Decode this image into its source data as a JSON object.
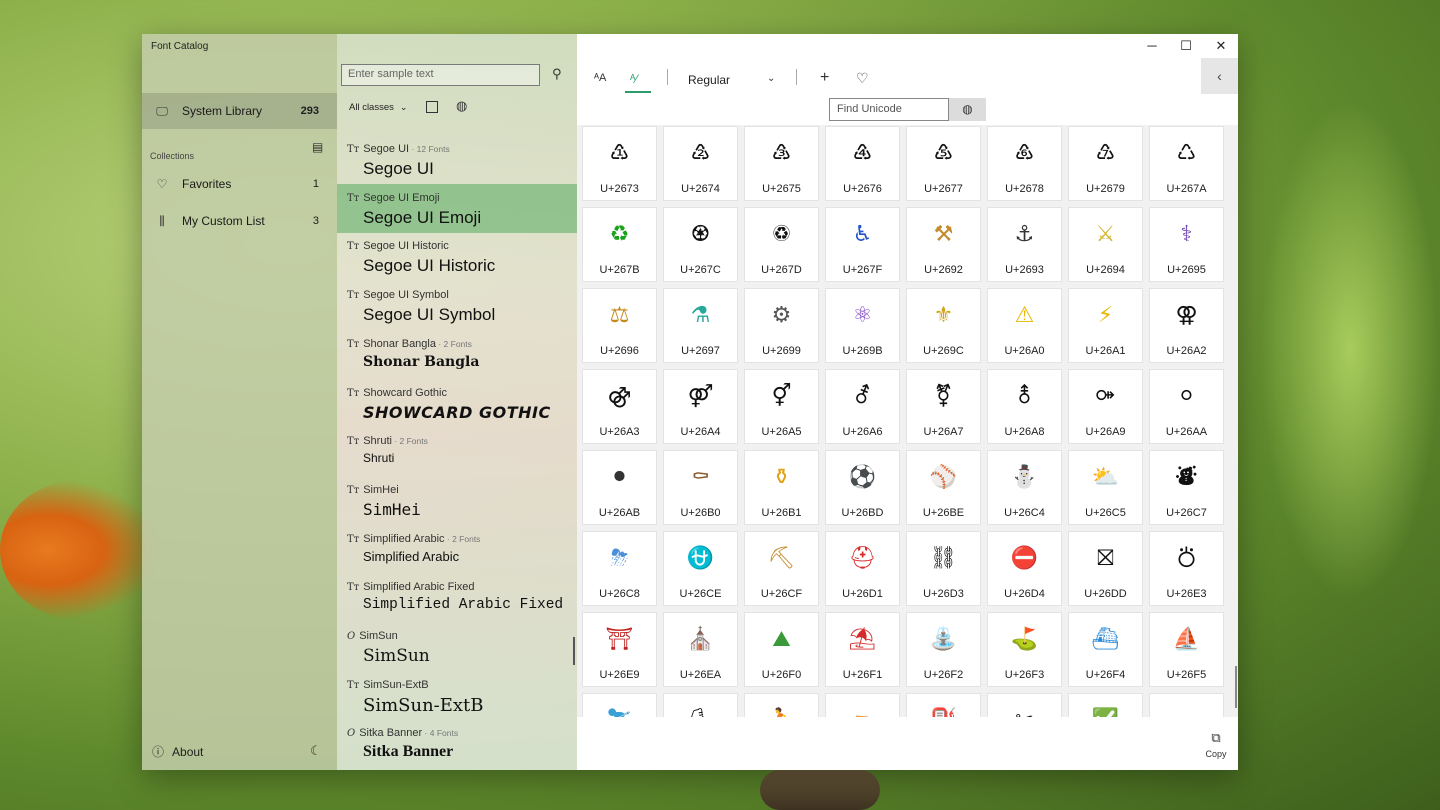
{
  "app": {
    "title": "Font Catalog"
  },
  "nav": {
    "system_library": {
      "label": "System Library",
      "count": "293",
      "icon": "monitor-icon"
    },
    "collections_label": "Collections",
    "favorites": {
      "label": "Favorites",
      "count": "1",
      "icon": "heart-icon"
    },
    "custom_list": {
      "label": "My Custom List",
      "count": "3",
      "icon": "books-icon"
    },
    "about_label": "About"
  },
  "fontlist": {
    "search_placeholder": "Enter sample text",
    "filter_label": "All classes",
    "fonts": [
      {
        "name": "Segoe UI",
        "sub": " · 12 Fonts",
        "sample": "Segoe UI",
        "icon": "TT"
      },
      {
        "name": "Segoe UI Emoji",
        "sub": "",
        "sample": "Segoe UI Emoji",
        "icon": "TT"
      },
      {
        "name": "Segoe UI Historic",
        "sub": "",
        "sample": "Segoe UI Historic",
        "icon": "TT"
      },
      {
        "name": "Segoe UI Symbol",
        "sub": "",
        "sample": "Segoe UI Symbol",
        "icon": "TT"
      },
      {
        "name": "Shonar Bangla",
        "sub": " · 2 Fonts",
        "sample": "Shonar Bangla",
        "icon": "TT"
      },
      {
        "name": "Showcard Gothic",
        "sub": "",
        "sample": "SHOWCARD GOTHIC",
        "icon": "TT"
      },
      {
        "name": "Shruti",
        "sub": " · 2 Fonts",
        "sample": "Shruti",
        "icon": "TT"
      },
      {
        "name": "SimHei",
        "sub": "",
        "sample": "SimHei",
        "icon": "TT"
      },
      {
        "name": "Simplified Arabic",
        "sub": " · 2 Fonts",
        "sample": "Simplified Arabic",
        "icon": "TT"
      },
      {
        "name": "Simplified Arabic Fixed",
        "sub": "",
        "sample": "Simplified Arabic Fixed",
        "icon": "TT"
      },
      {
        "name": "SimSun",
        "sub": "",
        "sample": "SimSun",
        "icon": "O"
      },
      {
        "name": "SimSun-ExtB",
        "sub": "",
        "sample": "SimSun-ExtB",
        "icon": "TT"
      },
      {
        "name": "Sitka Banner",
        "sub": " · 4 Fonts",
        "sample": "Sitka Banner",
        "icon": "O"
      }
    ]
  },
  "toolbar": {
    "weight": "Regular",
    "find_placeholder": "Find Unicode",
    "copy_label": "Copy"
  },
  "glyphs": [
    {
      "code": "U+2673",
      "ch": "♳"
    },
    {
      "code": "U+2674",
      "ch": "♴"
    },
    {
      "code": "U+2675",
      "ch": "♵"
    },
    {
      "code": "U+2676",
      "ch": "♶"
    },
    {
      "code": "U+2677",
      "ch": "♷"
    },
    {
      "code": "U+2678",
      "ch": "♸"
    },
    {
      "code": "U+2679",
      "ch": "♹"
    },
    {
      "code": "U+267A",
      "ch": "♺"
    },
    {
      "code": "U+267B",
      "ch": "♻",
      "color": "#1aa31a"
    },
    {
      "code": "U+267C",
      "ch": "♼"
    },
    {
      "code": "U+267D",
      "ch": "♽"
    },
    {
      "code": "U+267F",
      "ch": "♿",
      "color": "#2255cc"
    },
    {
      "code": "U+2692",
      "ch": "⚒",
      "color": "#c48a2c"
    },
    {
      "code": "U+2693",
      "ch": "⚓",
      "color": "#333333"
    },
    {
      "code": "U+2694",
      "ch": "⚔",
      "color": "#d4b22a"
    },
    {
      "code": "U+2695",
      "ch": "⚕",
      "color": "#6a3fb0"
    },
    {
      "code": "U+2696",
      "ch": "⚖",
      "color": "#c48a1c"
    },
    {
      "code": "U+2697",
      "ch": "⚗",
      "color": "#2aa79b"
    },
    {
      "code": "U+2699",
      "ch": "⚙",
      "color": "#555555"
    },
    {
      "code": "U+269B",
      "ch": "⚛",
      "color": "#7a3fc4"
    },
    {
      "code": "U+269C",
      "ch": "⚜",
      "color": "#d4a21a"
    },
    {
      "code": "U+26A0",
      "ch": "⚠",
      "color": "#e8b800"
    },
    {
      "code": "U+26A1",
      "ch": "⚡",
      "color": "#e8b800"
    },
    {
      "code": "U+26A2",
      "ch": "⚢"
    },
    {
      "code": "U+26A3",
      "ch": "⚣"
    },
    {
      "code": "U+26A4",
      "ch": "⚤"
    },
    {
      "code": "U+26A5",
      "ch": "⚥"
    },
    {
      "code": "U+26A6",
      "ch": "⚦"
    },
    {
      "code": "U+26A7",
      "ch": "⚧"
    },
    {
      "code": "U+26A8",
      "ch": "⚨"
    },
    {
      "code": "U+26A9",
      "ch": "⚩"
    },
    {
      "code": "U+26AA",
      "ch": "⚪"
    },
    {
      "code": "U+26AB",
      "ch": "⚫",
      "color": "#333333"
    },
    {
      "code": "U+26B0",
      "ch": "⚰",
      "color": "#8a5a2a"
    },
    {
      "code": "U+26B1",
      "ch": "⚱",
      "color": "#e0a21a"
    },
    {
      "code": "U+26BD",
      "ch": "⚽"
    },
    {
      "code": "U+26BE",
      "ch": "⚾",
      "color": "#c0392b"
    },
    {
      "code": "U+26C4",
      "ch": "⛄"
    },
    {
      "code": "U+26C5",
      "ch": "⛅",
      "color": "#e8b800"
    },
    {
      "code": "U+26C7",
      "ch": "⛇"
    },
    {
      "code": "U+26C8",
      "ch": "⛈",
      "color": "#4a90d9"
    },
    {
      "code": "U+26CE",
      "ch": "⛎",
      "color": "#6a3fb0"
    },
    {
      "code": "U+26CF",
      "ch": "⛏",
      "color": "#c48a2c"
    },
    {
      "code": "U+26D1",
      "ch": "⛑",
      "color": "#d62b2b"
    },
    {
      "code": "U+26D3",
      "ch": "⛓"
    },
    {
      "code": "U+26D4",
      "ch": "⛔",
      "color": "#d62b2b"
    },
    {
      "code": "U+26DD",
      "ch": "⛝"
    },
    {
      "code": "U+26E3",
      "ch": "⛣"
    },
    {
      "code": "U+26E9",
      "ch": "⛩",
      "color": "#c0221f"
    },
    {
      "code": "U+26EA",
      "ch": "⛪",
      "color": "#c0392b"
    },
    {
      "code": "U+26F0",
      "ch": "⛰",
      "color": "#3a9a3a"
    },
    {
      "code": "U+26F1",
      "ch": "⛱",
      "color": "#d62b2b"
    },
    {
      "code": "U+26F2",
      "ch": "⛲",
      "color": "#3aa0d8"
    },
    {
      "code": "U+26F3",
      "ch": "⛳",
      "color": "#3a9a3a"
    },
    {
      "code": "U+26F4",
      "ch": "⛴",
      "color": "#2a8ad8"
    },
    {
      "code": "U+26F5",
      "ch": "⛵",
      "color": "#d4a21a"
    }
  ],
  "partial_row": [
    {
      "ch": "⛷",
      "color": "#3aa0d8"
    },
    {
      "ch": "⛸"
    },
    {
      "ch": "⛹",
      "color": "#c48a2c"
    },
    {
      "ch": "⛺",
      "color": "#3a9a3a"
    },
    {
      "ch": "⛽"
    },
    {
      "ch": "✂"
    },
    {
      "ch": "✅",
      "color": "#d62b2b"
    },
    {
      "ch": ""
    }
  ]
}
